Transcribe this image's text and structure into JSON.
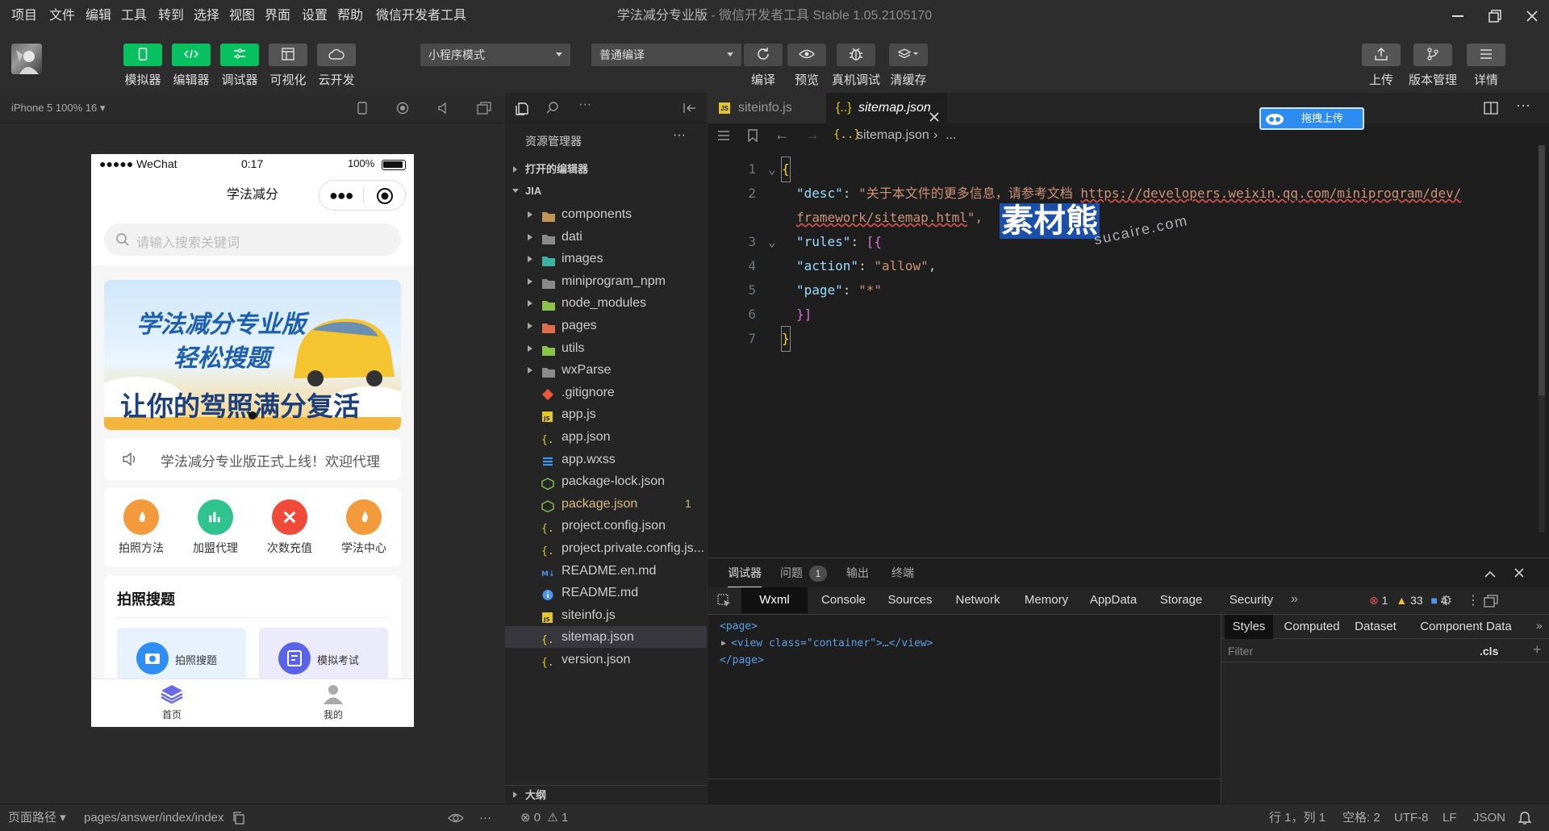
{
  "menubar": {
    "items": [
      "项目",
      "文件",
      "编辑",
      "工具",
      "转到",
      "选择",
      "视图",
      "界面",
      "设置",
      "帮助",
      "微信开发者工具"
    ],
    "title": "学法减分专业版",
    "title_suffix": " - 微信开发者工具 Stable 1.05.2105170"
  },
  "toolbar": {
    "left_buttons": [
      {
        "label": "模拟器",
        "icon": "phone-icon"
      },
      {
        "label": "编辑器",
        "icon": "code-icon"
      },
      {
        "label": "调试器",
        "icon": "debug-icon"
      },
      {
        "label": "可视化",
        "icon": "layout-icon"
      },
      {
        "label": "云开发",
        "icon": "cloud-icon"
      }
    ],
    "mode_select": "小程序模式",
    "compile_select": "普通编译",
    "mid_buttons": [
      {
        "label": "编译",
        "icon": "refresh-icon"
      },
      {
        "label": "预览",
        "icon": "eye-icon"
      },
      {
        "label": "真机调试",
        "icon": "bug-icon"
      },
      {
        "label": "清缓存",
        "icon": "layers-icon"
      }
    ],
    "right_buttons": [
      {
        "label": "上传",
        "icon": "upload-icon"
      },
      {
        "label": "版本管理",
        "icon": "branch-icon"
      },
      {
        "label": "详情",
        "icon": "menu-icon"
      }
    ]
  },
  "simulator": {
    "device": "iPhone 5 100% 16",
    "status": {
      "carrier": "●●●●● WeChat",
      "time": "0:17",
      "battery": "100%"
    },
    "nav_title": "学法减分",
    "search_placeholder": "请输入搜索关键词",
    "banner": {
      "line1": "学法减分专业版",
      "line2": "轻松搜题",
      "line3": "让你的驾照满分复活"
    },
    "notice": "学法减分专业版正式上线！欢迎代理",
    "grid": [
      {
        "label": "拍照方法",
        "color": "#f39a3c"
      },
      {
        "label": "加盟代理",
        "color": "#2fc38f"
      },
      {
        "label": "次数充值",
        "color": "#ef4a3a"
      },
      {
        "label": "学法中心",
        "color": "#f39a3c"
      }
    ],
    "section_title": "拍照搜题",
    "cards": [
      {
        "label": "拍照搜题",
        "color": "#2f8ef5"
      },
      {
        "label": "模拟考试",
        "color": "#5a63e8"
      }
    ],
    "tabbar": [
      {
        "label": "首页",
        "active": true
      },
      {
        "label": "我的",
        "active": false
      }
    ]
  },
  "explorer": {
    "title": "资源管理器",
    "open_editors": "打开的编辑器",
    "root": "JIA",
    "outline": "大纲",
    "files": [
      {
        "name": "components",
        "kind": "folder",
        "color": "#c09553"
      },
      {
        "name": "dati",
        "kind": "folder",
        "color": "#8a8a8a"
      },
      {
        "name": "images",
        "kind": "folder",
        "color": "#3fb3a3"
      },
      {
        "name": "miniprogram_npm",
        "kind": "folder",
        "color": "#8a8a8a"
      },
      {
        "name": "node_modules",
        "kind": "folder",
        "color": "#8bc34a"
      },
      {
        "name": "pages",
        "kind": "folder",
        "color": "#e06c4c"
      },
      {
        "name": "utils",
        "kind": "folder",
        "color": "#8bc34a"
      },
      {
        "name": "wxParse",
        "kind": "folder",
        "color": "#8a8a8a"
      },
      {
        "name": ".gitignore",
        "kind": "git",
        "color": "#e8583a"
      },
      {
        "name": "app.js",
        "kind": "js",
        "color": "#e2c52b"
      },
      {
        "name": "app.json",
        "kind": "json",
        "color": "#e2c52b"
      },
      {
        "name": "app.wxss",
        "kind": "css",
        "color": "#3b9af0"
      },
      {
        "name": "package-lock.json",
        "kind": "npm",
        "color": "#8bc34a"
      },
      {
        "name": "package.json",
        "kind": "npm",
        "color": "#8bc34a",
        "badge": "1"
      },
      {
        "name": "project.config.json",
        "kind": "json",
        "color": "#e2c52b"
      },
      {
        "name": "project.private.config.js...",
        "kind": "json",
        "color": "#e2c52b"
      },
      {
        "name": "README.en.md",
        "kind": "md",
        "color": "#4f95e8"
      },
      {
        "name": "README.md",
        "kind": "info",
        "color": "#4f95e8"
      },
      {
        "name": "siteinfo.js",
        "kind": "js",
        "color": "#e2c52b"
      },
      {
        "name": "sitemap.json",
        "kind": "json",
        "color": "#e2c52b",
        "selected": true
      },
      {
        "name": "version.json",
        "kind": "json",
        "color": "#e2c52b"
      }
    ]
  },
  "editor": {
    "tabs": [
      {
        "name": "siteinfo.js",
        "active": false
      },
      {
        "name": "sitemap.json",
        "active": true
      }
    ],
    "breadcrumb": [
      "sitemap.json",
      "..."
    ],
    "upload_badge": "拖拽上传",
    "lines": [
      "1",
      "2",
      "",
      "3",
      "4",
      "5",
      "6",
      "7"
    ],
    "code": {
      "open": "{",
      "desc_key": "\"desc\"",
      "desc_val": "\"关于本文件的更多信息，请参考文档 ",
      "url1": "https://developers.weixin.qq.com/miniprogram/dev/",
      "url2": "framework/sitemap.html",
      "desc_end": "\",",
      "rules_key": "\"rules\"",
      "rules_open": "[{",
      "action_key": "\"action\"",
      "action_val": "\"allow\"",
      "page_key": "\"page\"",
      "page_val": "\"*\"",
      "rules_close": "}]",
      "close": "}",
      "colon": ": ",
      "comma": ","
    },
    "watermark": {
      "main": "素材熊",
      "sub": "sucaire.com"
    }
  },
  "debugger": {
    "panel_tabs": [
      {
        "label": "调试器",
        "active": true
      },
      {
        "label": "问题",
        "badge": "1"
      },
      {
        "label": "输出"
      },
      {
        "label": "终端"
      }
    ],
    "devtools_tabs": [
      "Wxml",
      "Console",
      "Sources",
      "Network",
      "Memory",
      "AppData",
      "Storage",
      "Security"
    ],
    "counts": {
      "errors": "1",
      "warnings": "33",
      "info": "4"
    },
    "wxml": [
      "<page>",
      "<view class=\"container\">…</view>",
      "</page>"
    ],
    "style_tabs": [
      "Styles",
      "Computed",
      "Dataset",
      "Component Data"
    ],
    "filter_placeholder": "Filter",
    "cls": ".cls"
  },
  "statusbar": {
    "page_path_label": "页面路径",
    "page_path": "pages/answer/index/index",
    "errors": "0",
    "warnings": "1",
    "position": "行 1，列 1",
    "indent": "空格: 2",
    "encoding": "UTF-8",
    "eol": "LF",
    "language": "JSON"
  }
}
